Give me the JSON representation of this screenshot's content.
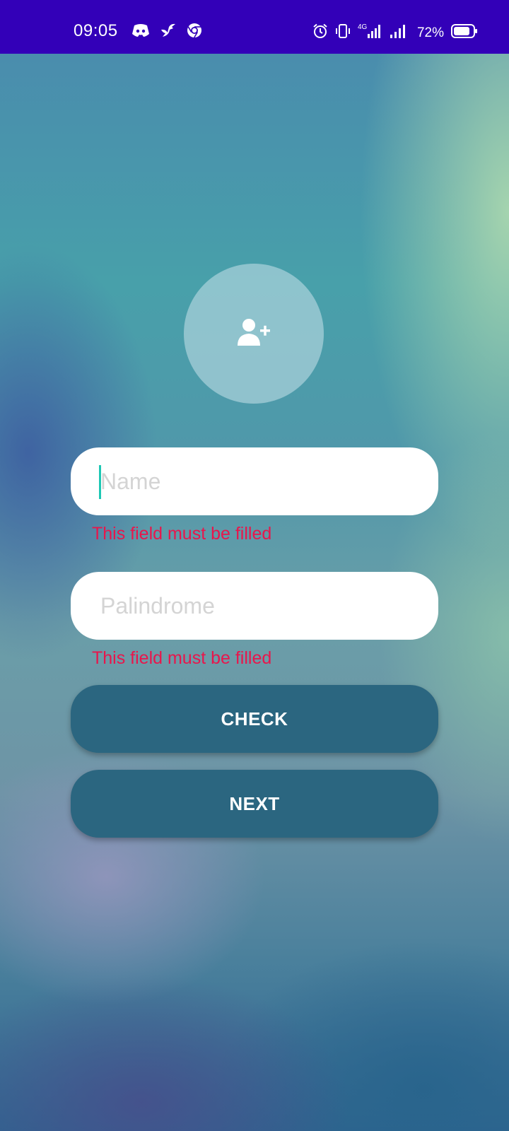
{
  "status_bar": {
    "time": "09:05",
    "network": "4G",
    "battery": "72%",
    "left_icons": [
      "discord-icon",
      "bird-icon",
      "chrome-icon"
    ],
    "right_icons": [
      "alarm-icon",
      "vibrate-icon",
      "signal-4g-icon",
      "signal-icon",
      "battery-icon"
    ],
    "background_color": "#3300b8"
  },
  "avatar": {
    "icon": "add-user-icon"
  },
  "form": {
    "name_placeholder": "Name",
    "name_value": "",
    "name_error": "This field must be filled",
    "palindrome_placeholder": "Palindrome",
    "palindrome_value": "",
    "palindrome_error": "This field must be filled"
  },
  "buttons": {
    "check_label": "CHECK",
    "next_label": "NEXT"
  },
  "colors": {
    "button": "#2b6680",
    "error": "#e8164c",
    "cursor": "#1ec8b4"
  }
}
